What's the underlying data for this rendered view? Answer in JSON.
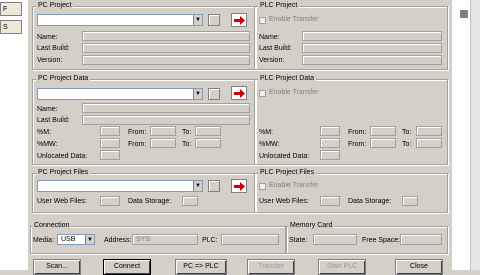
{
  "left_tabs": [
    "F",
    "S"
  ],
  "pc_project": {
    "title": "PC Project",
    "name_label": "Name:",
    "last_build_label": "Last Build:",
    "version_label": "Version:"
  },
  "plc_project": {
    "title": "PLC Project",
    "enable_label": "Enable Transfer",
    "name_label": "Name:",
    "last_build_label": "Last Build:",
    "version_label": "Version:"
  },
  "pc_project_data": {
    "title": "PC Project Data",
    "name_label": "Name:",
    "last_build_label": "Last Build:",
    "xm_label": "%M:",
    "smw_label": "%MW:",
    "unlocated_label": "Unlocated Data:",
    "from_label": "From:",
    "to_label": "To:"
  },
  "plc_project_data": {
    "title": "PLC Project Data",
    "enable_label": "Enable Transfer",
    "xm_label": "%M:",
    "smw_label": "%MW:",
    "unlocated_label": "Unlocated Data:",
    "from_label": "From:",
    "to_label": "To:"
  },
  "pc_project_files": {
    "title": "PC Project Files",
    "user_web_label": "User Web Files:",
    "data_storage_label": "Data Storage:"
  },
  "plc_project_files": {
    "title": "PLC Project Files",
    "enable_label": "Enable Transfer",
    "user_web_label": "User Web Files:",
    "data_storage_label": "Data Storage:"
  },
  "connection": {
    "title": "Connection",
    "media_label": "Media:",
    "media_value": "USB",
    "address_label": "Address:",
    "address_value": "SYS",
    "plc_label": "PLC:"
  },
  "memory_card": {
    "title": "Memory Card",
    "state_label": "State:",
    "free_space_label": "Free Space:"
  },
  "buttons": {
    "scan": "Scan...",
    "connect": "Connect",
    "pc_to_plc": "PC => PLC",
    "transfer": "Transfer",
    "start_plc": "Start PLC",
    "close": "Close"
  },
  "colors": {
    "arrow_red": "#cc0000",
    "dialog_bg": "#d4d0c8"
  }
}
